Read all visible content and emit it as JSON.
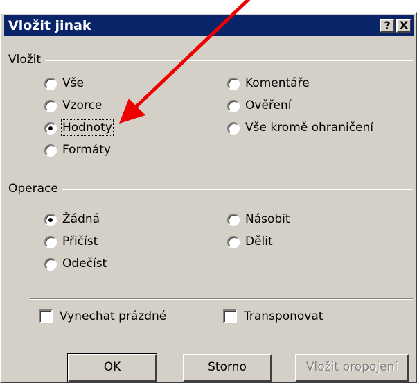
{
  "dialog": {
    "title": "Vložit jinak",
    "help_btn": "?",
    "close_btn": "X"
  },
  "paste_group": {
    "label": "Vložit",
    "options": [
      "Vše",
      "Vzorce",
      "Hodnoty",
      "Formáty",
      "Komentáře",
      "Ověření",
      "Vše kromě ohraničení"
    ],
    "selected": "Hodnoty"
  },
  "operation_group": {
    "label": "Operace",
    "options": [
      "Žádná",
      "Přičíst",
      "Odečíst",
      "Násobit",
      "Dělit"
    ],
    "selected": "Žádná"
  },
  "checkboxes": {
    "skip_blanks": "Vynechat prázdné",
    "transpose": "Transponovat"
  },
  "buttons": {
    "ok": "OK",
    "cancel": "Storno",
    "paste_link": "Vložit propojení"
  },
  "colors": {
    "titlebar": "#0a246a",
    "face": "#d4d0c8",
    "annotation_arrow": "#ee0000"
  }
}
